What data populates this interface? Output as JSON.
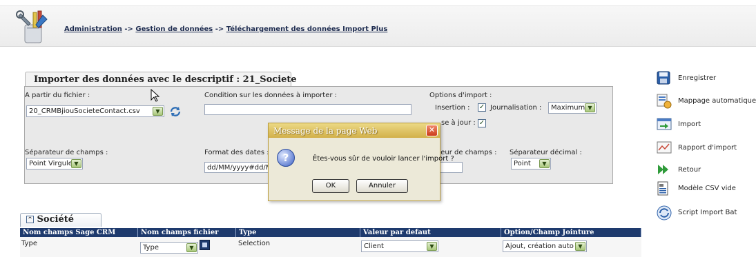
{
  "breadcrumb": {
    "item1": "Administration",
    "sep1": "->",
    "item2": "Gestion de données",
    "sep2": "->",
    "item3": "Téléchargement des données Import Plus"
  },
  "import_panel": {
    "title": "Importer des données avec le descriptif : 21_Societe",
    "file_label": "A partir du fichier :",
    "file_value": "20_CRMBjiouSocieteContact.csv",
    "condition_label": "Condition sur les données à importer :",
    "condition_value": "",
    "options_label": "Options d'import :",
    "insertion_label": "Insertion :",
    "insertion_checked": "✓",
    "update_label": "se à jour :",
    "update_checked": "✓",
    "journal_label": "Journalisation :",
    "journal_value": "Maximum",
    "field_sep_label": "Séparateur de champs :",
    "field_sep_value": "Point Virgule",
    "date_format_label": "Format des dates :",
    "date_format_value": "dd/MM/yyyy#dd/MM",
    "delimiter_label": "imiteur de champs :",
    "decimal_sep_label": "Séparateur décimal :",
    "decimal_sep_value": "Point"
  },
  "societe": {
    "tab_label": "Société",
    "headers": [
      "Nom champs Sage CRM",
      "Nom champs fichier",
      "Type",
      "Valeur par defaut",
      "Option/Champ Jointure"
    ],
    "row": {
      "sage_field": "Type",
      "file_field": "Type",
      "type": "Selection",
      "default_value": "Client",
      "join_option": "Ajout, création auto"
    }
  },
  "sidebar": {
    "save": "Enregistrer",
    "auto_mapping": "Mappage automatique",
    "import": "Import",
    "report": "Rapport d'import",
    "back": "Retour",
    "csv_template": "Modèle CSV vide",
    "script": "Script Import Bat"
  },
  "dialog": {
    "title": "Message de la page Web",
    "close": "✕",
    "icon": "?",
    "message": "Êtes-vous sûr de vouloir lancer l'import ?",
    "ok": "OK",
    "cancel": "Annuler"
  },
  "colors": {
    "grid_header": "#1e3a6d",
    "dialog_title": "#d2b04a",
    "link": "#1d2b4f"
  }
}
